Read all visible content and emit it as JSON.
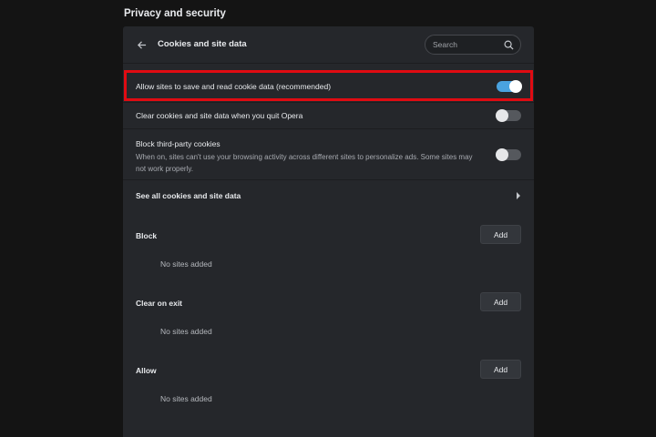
{
  "section_title": "Privacy and security",
  "header": {
    "title": "Cookies and site data",
    "search_placeholder": "Search"
  },
  "settings": [
    {
      "label": "Allow sites to save and read cookie data (recommended)",
      "enabled": true
    },
    {
      "label": "Clear cookies and site data when you quit Opera",
      "enabled": false
    },
    {
      "label": "Block third-party cookies",
      "description": "When on, sites can't use your browsing activity across different sites to personalize ads. Some sites may not work properly.",
      "enabled": false
    }
  ],
  "see_all": {
    "label": "See all cookies and site data"
  },
  "groups": [
    {
      "label": "Block",
      "button": "Add",
      "empty": "No sites added"
    },
    {
      "label": "Clear on exit",
      "button": "Add",
      "empty": "No sites added"
    },
    {
      "label": "Allow",
      "button": "Add",
      "empty": "No sites added"
    }
  ],
  "colors": {
    "accent": "#4aa3e0",
    "highlight": "#e00b12",
    "card": "#25272b",
    "background": "#141414"
  }
}
